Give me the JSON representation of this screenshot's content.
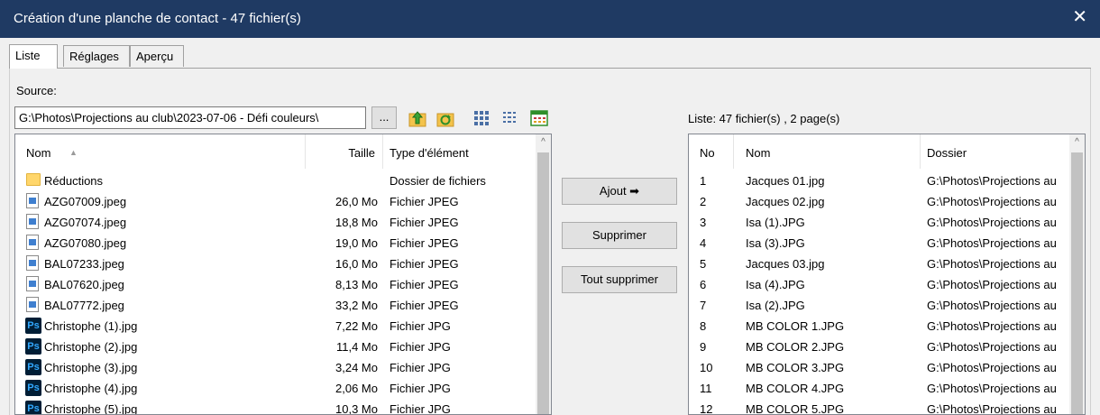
{
  "window": {
    "title": "Création d'une planche de contact - 47 fichier(s)",
    "close_glyph": "✕"
  },
  "tabs": [
    {
      "label": "Liste"
    },
    {
      "label": "Réglages"
    },
    {
      "label": "Aperçu"
    }
  ],
  "source": {
    "label": "Source:",
    "path": "G:\\Photos\\Projections au club\\2023-07-06 - Défi couleurs\\",
    "browse_label": "...",
    "toolbar_icons": [
      "folder-up-icon",
      "refresh-icon",
      "thumbnails-view-icon",
      "list-view-icon",
      "details-view-icon"
    ]
  },
  "left_list": {
    "columns": [
      "Nom",
      "Taille",
      "Type d'élément"
    ],
    "sort_glyph": "▲",
    "scroll_glyph": "^",
    "rows": [
      {
        "icon": "folder",
        "name": "Réductions",
        "size": "",
        "type": "Dossier de fichiers"
      },
      {
        "icon": "jpeg",
        "name": "AZG07009.jpeg",
        "size": "26,0 Mo",
        "type": "Fichier JPEG"
      },
      {
        "icon": "jpeg",
        "name": "AZG07074.jpeg",
        "size": "18,8 Mo",
        "type": "Fichier JPEG"
      },
      {
        "icon": "jpeg",
        "name": "AZG07080.jpeg",
        "size": "19,0 Mo",
        "type": "Fichier JPEG"
      },
      {
        "icon": "jpeg",
        "name": "BAL07233.jpeg",
        "size": "16,0 Mo",
        "type": "Fichier JPEG"
      },
      {
        "icon": "jpeg",
        "name": "BAL07620.jpeg",
        "size": "8,13 Mo",
        "type": "Fichier JPEG"
      },
      {
        "icon": "jpeg",
        "name": "BAL07772.jpeg",
        "size": "33,2 Mo",
        "type": "Fichier JPEG"
      },
      {
        "icon": "ps",
        "name": "Christophe (1).jpg",
        "size": "7,22 Mo",
        "type": "Fichier JPG"
      },
      {
        "icon": "ps",
        "name": "Christophe (2).jpg",
        "size": "11,4 Mo",
        "type": "Fichier JPG"
      },
      {
        "icon": "ps",
        "name": "Christophe (3).jpg",
        "size": "3,24 Mo",
        "type": "Fichier JPG"
      },
      {
        "icon": "ps",
        "name": "Christophe (4).jpg",
        "size": "2,06 Mo",
        "type": "Fichier JPG"
      },
      {
        "icon": "ps",
        "name": "Christophe (5).jpg",
        "size": "10,3 Mo",
        "type": "Fichier JPG"
      }
    ]
  },
  "ps_icon_text": "Ps",
  "buttons": {
    "add": "Ajout ➡",
    "remove": "Supprimer",
    "remove_all": "Tout supprimer"
  },
  "right_list": {
    "info": "Liste: 47 fichier(s) , 2 page(s)",
    "columns": [
      "No",
      "Nom",
      "Dossier"
    ],
    "scroll_glyph": "^",
    "rows": [
      {
        "no": "1",
        "name": "Jacques 01.jpg",
        "folder": "G:\\Photos\\Projections au"
      },
      {
        "no": "2",
        "name": "Jacques 02.jpg",
        "folder": "G:\\Photos\\Projections au"
      },
      {
        "no": "3",
        "name": "Isa (1).JPG",
        "folder": "G:\\Photos\\Projections au"
      },
      {
        "no": "4",
        "name": "Isa (3).JPG",
        "folder": "G:\\Photos\\Projections au"
      },
      {
        "no": "5",
        "name": "Jacques 03.jpg",
        "folder": "G:\\Photos\\Projections au"
      },
      {
        "no": "6",
        "name": "Isa (4).JPG",
        "folder": "G:\\Photos\\Projections au"
      },
      {
        "no": "7",
        "name": "Isa (2).JPG",
        "folder": "G:\\Photos\\Projections au"
      },
      {
        "no": "8",
        "name": "MB COLOR 1.JPG",
        "folder": "G:\\Photos\\Projections au"
      },
      {
        "no": "9",
        "name": "MB COLOR 2.JPG",
        "folder": "G:\\Photos\\Projections au"
      },
      {
        "no": "10",
        "name": "MB COLOR 3.JPG",
        "folder": "G:\\Photos\\Projections au"
      },
      {
        "no": "11",
        "name": "MB COLOR 4.JPG",
        "folder": "G:\\Photos\\Projections au"
      },
      {
        "no": "12",
        "name": "MB COLOR 5.JPG",
        "folder": "G:\\Photos\\Projections au"
      }
    ]
  },
  "colors": {
    "titlebar": "#1f3a63",
    "background": "#f0f0f0"
  }
}
